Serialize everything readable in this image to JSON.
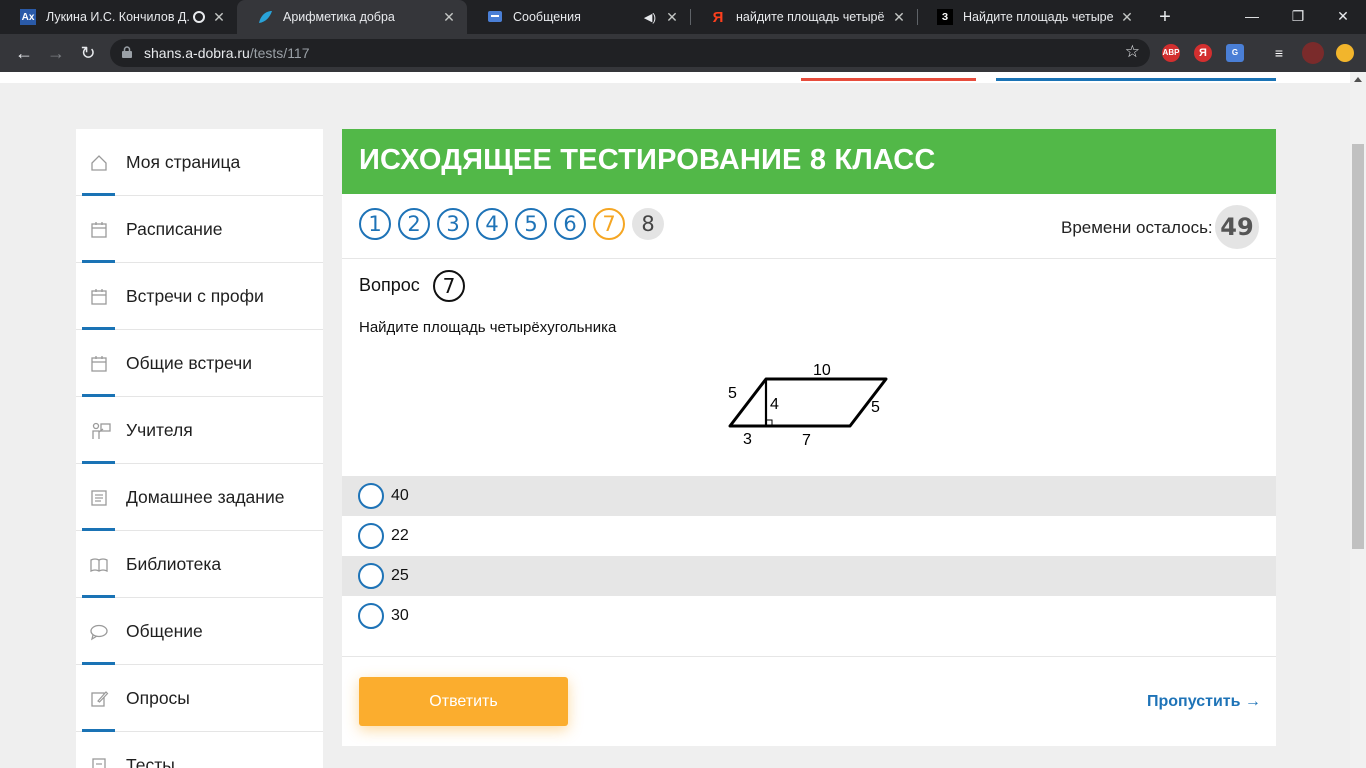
{
  "browser": {
    "tabs": [
      {
        "title": "Лукина И.С. Кончилов Д.",
        "favicon": "Ax",
        "active": false
      },
      {
        "title": "Арифметика добра",
        "favicon": "leaf-icon",
        "active": true
      },
      {
        "title": "Сообщения",
        "favicon": "message-icon",
        "active": false
      },
      {
        "title": "найдите площадь четырёхуго",
        "favicon": "Я",
        "active": false
      },
      {
        "title": "Найдите площадь четырехуго",
        "favicon": "З",
        "active": false
      }
    ],
    "url_host": "shans.a-dobra.ru",
    "url_path": "/tests/117",
    "extensions": [
      "ABP",
      "Я"
    ]
  },
  "sidebar": {
    "items": [
      {
        "label": "Моя страница",
        "icon": "home-icon"
      },
      {
        "label": "Расписание",
        "icon": "calendar-icon"
      },
      {
        "label": "Встречи с профи",
        "icon": "calendar-icon"
      },
      {
        "label": "Общие встречи",
        "icon": "calendar-icon"
      },
      {
        "label": "Учителя",
        "icon": "teacher-icon"
      },
      {
        "label": "Домашнее задание",
        "icon": "homework-icon"
      },
      {
        "label": "Библиотека",
        "icon": "book-icon"
      },
      {
        "label": "Общение",
        "icon": "chat-icon"
      },
      {
        "label": "Опросы",
        "icon": "edit-icon"
      },
      {
        "label": "Тесты",
        "icon": "tests-icon"
      }
    ]
  },
  "test": {
    "title": "ИСХОДЯЩЕЕ ТЕСТИРОВАНИЕ 8 КЛАСС",
    "questions": [
      "1",
      "2",
      "3",
      "4",
      "5",
      "6",
      "7",
      "8"
    ],
    "current_question": "7",
    "timer_label": "Времени осталось:",
    "timer_value": "49",
    "question_label": "Вопрос",
    "question_number": "7",
    "question_text": "Найдите площадь четырёхугольника",
    "figure_labels": {
      "top": "10",
      "left": "5",
      "height": "4",
      "right": "5",
      "bottom_left": "3",
      "bottom_right": "7"
    },
    "options": [
      "40",
      "22",
      "25",
      "30"
    ],
    "submit_label": "Ответить",
    "skip_label": "Пропустить →"
  },
  "colors": {
    "banner": "#52b848",
    "accent_blue": "#1e73b7",
    "submit_orange": "#fbad2e"
  }
}
